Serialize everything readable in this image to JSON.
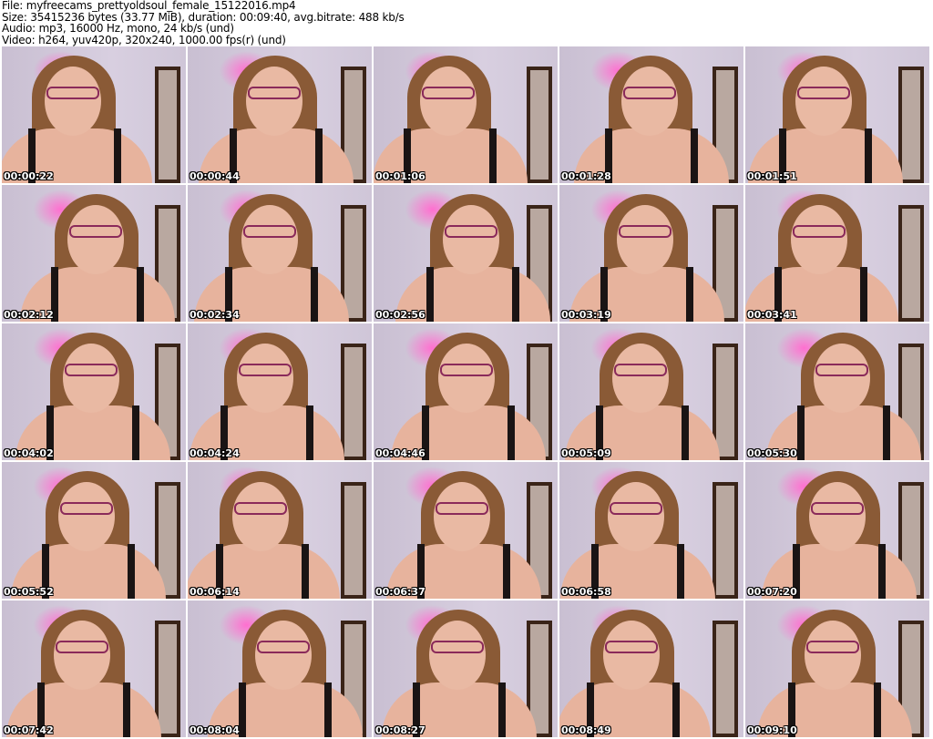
{
  "header": {
    "file": "File: myfreecams_prettyoldsoul_female_15122016.mp4",
    "size": "Size: 35415236 bytes (33.77 MiB), duration: 00:09:40, avg.bitrate: 488 kb/s",
    "audio": "Audio: mp3, 16000 Hz, mono, 24 kb/s (und)",
    "video": "Video: h264, yuv420p, 320x240, 1000.00 fps(r) (und)"
  },
  "thumbnails": [
    "00:00:22",
    "00:00:44",
    "00:01:06",
    "00:01:28",
    "00:01:51",
    "00:02:12",
    "00:02:34",
    "00:02:56",
    "00:03:19",
    "00:03:41",
    "00:04:02",
    "00:04:24",
    "00:04:46",
    "00:05:09",
    "00:05:30",
    "00:05:52",
    "00:06:14",
    "00:06:37",
    "00:06:58",
    "00:07:20",
    "00:07:42",
    "00:08:04",
    "00:08:27",
    "00:08:49",
    "00:09:10"
  ]
}
